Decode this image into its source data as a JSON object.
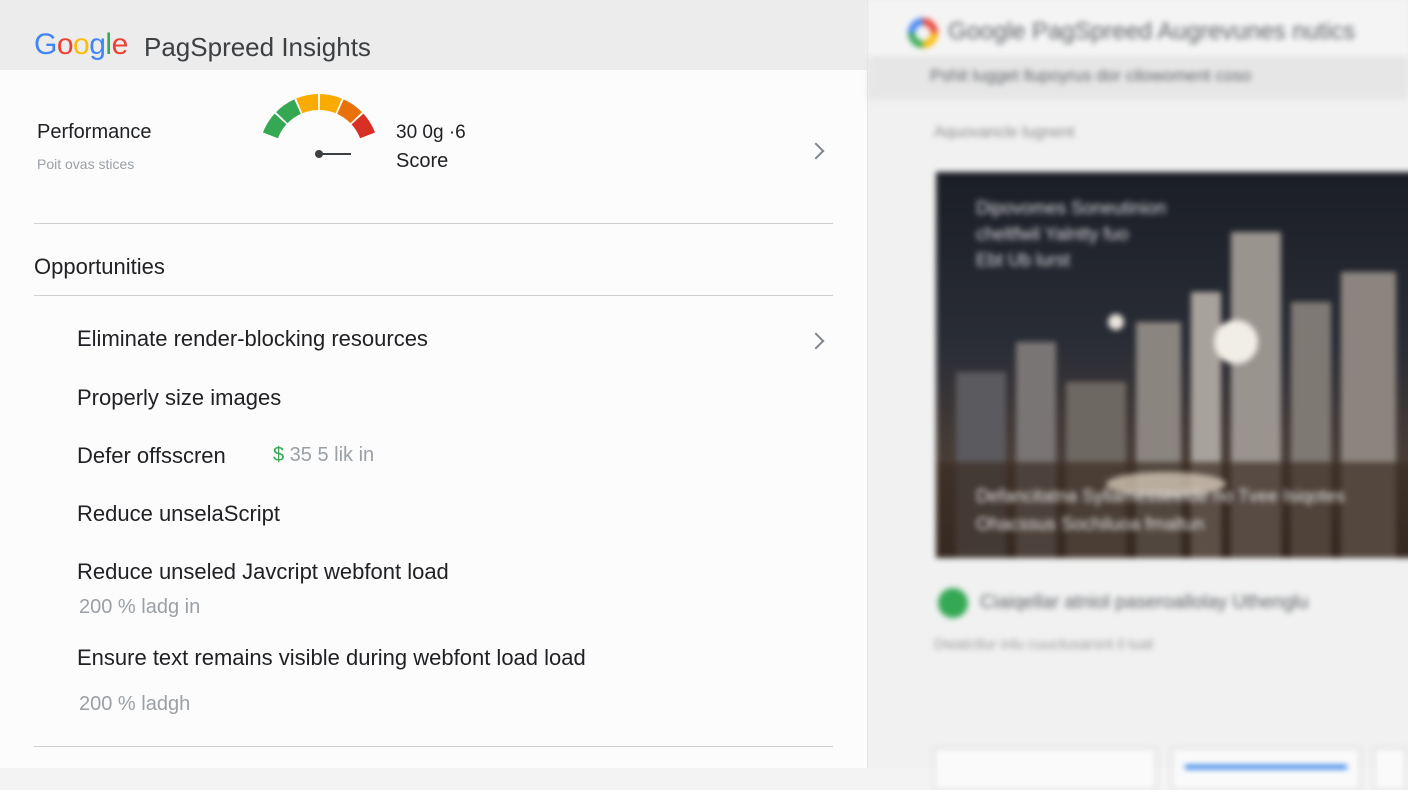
{
  "header": {
    "logo_letters": [
      {
        "ch": "G",
        "color": "#4285F4"
      },
      {
        "ch": "o",
        "color": "#EA4335"
      },
      {
        "ch": "o",
        "color": "#FBBC05"
      },
      {
        "ch": "g",
        "color": "#4285F4"
      },
      {
        "ch": "l",
        "color": "#34A853"
      },
      {
        "ch": "e",
        "color": "#EA4335"
      }
    ],
    "app_title": "PagSpreed Insights"
  },
  "performance": {
    "label": "Performance",
    "sublabel": "Poit ovas stices",
    "score_value": "30 0g ·6",
    "score_label": "Score",
    "gauge_colors": [
      "#34A853",
      "#34A853",
      "#F9AB00",
      "#F9AB00",
      "#E8710A",
      "#D93025"
    ]
  },
  "opportunities": {
    "heading": "Opportunities",
    "items": [
      {
        "label": "Eliminate render-blocking resources"
      },
      {
        "label": "Properly size images"
      },
      {
        "label": "Defer offsscren",
        "savings_currency": "$",
        "savings_text": " 35 5 lik in"
      },
      {
        "label": "Reduce unselaScript"
      },
      {
        "label": "Reduce unseled Javcript webfont load",
        "meta": "200 % ladg in"
      },
      {
        "label": "Ensure text remains visible during webfont load load",
        "meta": "200 % ladgh"
      }
    ]
  },
  "right_panel": {
    "title": "Google PagSpreed  Augrevunes nutics",
    "bar_text": "Pshit lugget llupoyrus dor cilowoment coso",
    "subtitle": "Aquovancle lugnent",
    "image_lines": [
      "Dipovomes Soneutinion",
      "cheltfwil Yalntty fuo",
      "Ebt Ub lurst",
      "Defancitatna Syllamesseelde no Tvee Isiqotes",
      "Ohacssus Sochiluoa fmaltun"
    ],
    "check_text": "Ciaiqellar atniol paseroallolay Uthenglu",
    "footer_text": "Dwatctlur inlu cuuctusarsnt il tuat"
  }
}
